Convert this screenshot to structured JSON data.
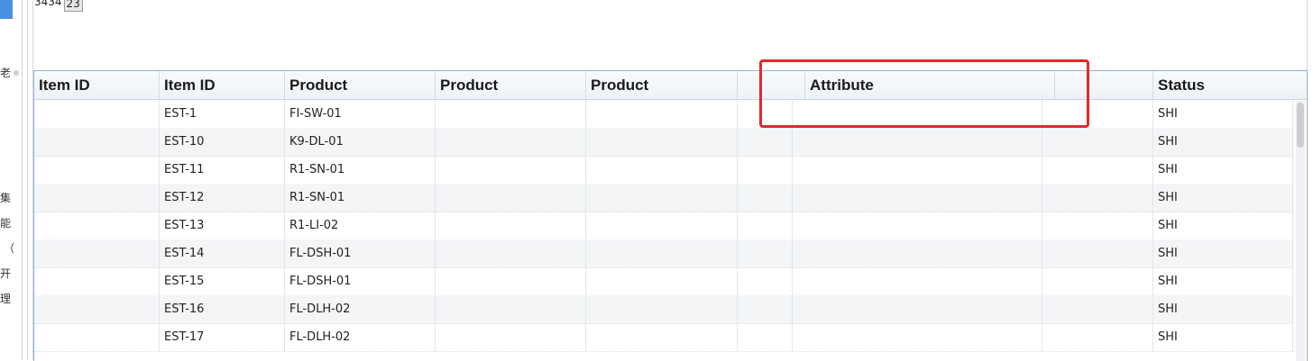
{
  "pager": {
    "total_text": "3434",
    "page_input": "23"
  },
  "sidebar": {
    "chars": [
      "老",
      "集",
      "能",
      "（",
      "开",
      "理"
    ]
  },
  "grid": {
    "headers": [
      "Item ID",
      "Item ID",
      "Product",
      "Product",
      "Product",
      "",
      "Attribute",
      "",
      "Status"
    ],
    "rows": [
      {
        "item": "EST-1",
        "product": "FI-SW-01",
        "status": "SHI"
      },
      {
        "item": "EST-10",
        "product": "K9-DL-01",
        "status": "SHI"
      },
      {
        "item": "EST-11",
        "product": "R1-SN-01",
        "status": "SHI"
      },
      {
        "item": "EST-12",
        "product": "R1-SN-01",
        "status": "SHI"
      },
      {
        "item": "EST-13",
        "product": "R1-LI-02",
        "status": "SHI"
      },
      {
        "item": "EST-14",
        "product": "FL-DSH-01",
        "status": "SHI"
      },
      {
        "item": "EST-15",
        "product": "FL-DSH-01",
        "status": "SHI"
      },
      {
        "item": "EST-16",
        "product": "FL-DLH-02",
        "status": "SHI"
      },
      {
        "item": "EST-17",
        "product": "FL-DLH-02",
        "status": "SHI"
      }
    ]
  },
  "colors": {
    "highlight_box": "#e02a2a",
    "grid_border": "#9db2cc",
    "sidebar_accent": "#4a90e2"
  }
}
